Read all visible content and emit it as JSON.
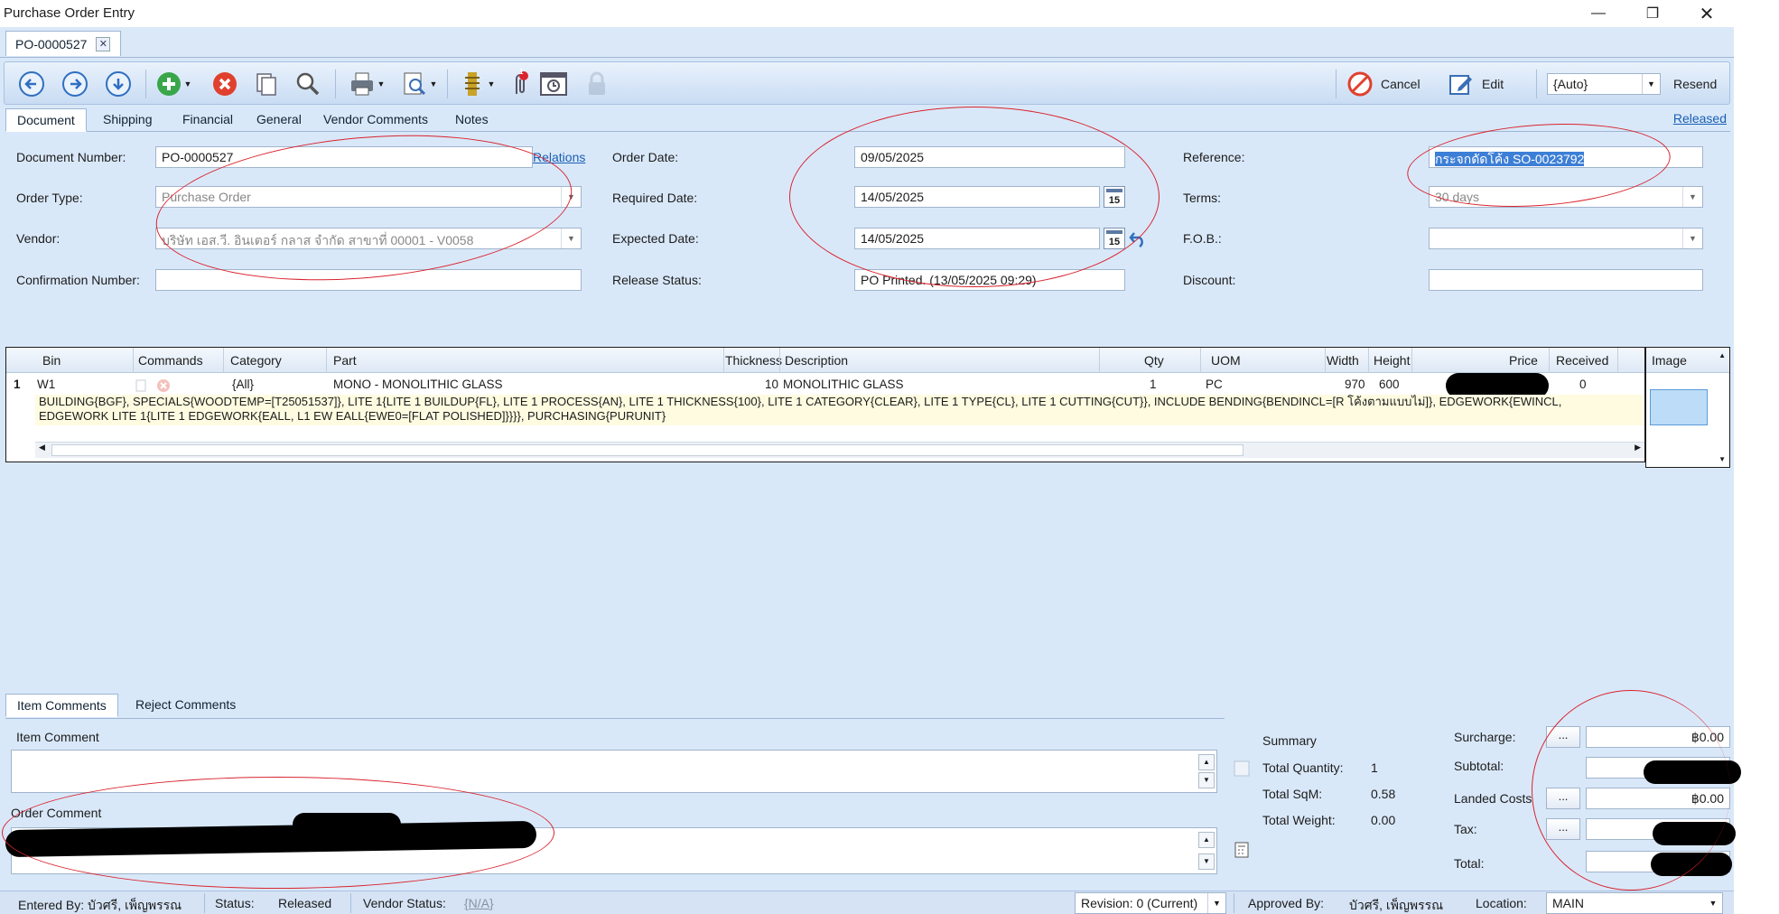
{
  "window": {
    "title": "Purchase Order Entry",
    "minimize": "—",
    "restore": "❐",
    "close": "✕"
  },
  "doc_tab": {
    "label": "PO-0000527",
    "close": "✕"
  },
  "toolbar": {
    "cancel_label": "Cancel",
    "edit_label": "Edit",
    "print_mode": "{Auto}",
    "resend_label": "Resend",
    "notification_count": "1"
  },
  "section_tabs": [
    "Document",
    "Shipping",
    "Financial",
    "General",
    "Vendor Comments",
    "Notes"
  ],
  "released_link": "Released",
  "form": {
    "document_number_label": "Document Number:",
    "document_number": "PO-0000527",
    "relations_link": "Relations",
    "order_type_label": "Order Type:",
    "order_type": "Purchase Order",
    "vendor_label": "Vendor:",
    "vendor": "บริษัท เอส.วี. อินเตอร์ กลาส  จำกัด สาขาที่ 00001 - V0058",
    "confirmation_number_label": "Confirmation Number:",
    "confirmation_number": "",
    "order_date_label": "Order Date:",
    "order_date": "09/05/2025",
    "required_date_label": "Required Date:",
    "required_date": "14/05/2025",
    "expected_date_label": "Expected Date:",
    "expected_date": "14/05/2025",
    "release_status_label": "Release Status:",
    "release_status": "PO Printed. (13/05/2025 09:29)",
    "reference_label": "Reference:",
    "reference": "กระจกดัดโค้ง SO-0023792",
    "terms_label": "Terms:",
    "terms": "30 days",
    "fob_label": "F.O.B.:",
    "fob": "",
    "discount_label": "Discount:",
    "discount": "",
    "calendar_day": "15"
  },
  "grid": {
    "headers": [
      "Bin",
      "Commands",
      "Category",
      "Part",
      "Thickness",
      "Description",
      "Qty",
      "UOM",
      "Width",
      "Height",
      "Price",
      "Received"
    ],
    "image_header": "Image",
    "row": {
      "num": "1",
      "bin": "W1",
      "category": "{All}",
      "part": "MONO - MONOLITHIC GLASS",
      "thickness": "10",
      "description": "MONOLITHIC GLASS",
      "qty": "1",
      "uom": "PC",
      "width": "970",
      "height": "600",
      "received": "0",
      "detail_line1": "BUILDING{BGF}, SPECIALS{WOODTEMP=[T25051537]}, LITE 1{LITE 1 BUILDUP{FL}, LITE 1 PROCESS{AN}, LITE 1 THICKNESS{100}, LITE 1 CATEGORY{CLEAR}, LITE 1 TYPE{CL}, LITE 1 CUTTING{CUT}}, INCLUDE BENDING{BENDINCL=[R โค้งตามแบบไม่]}, EDGEWORK{EWINCL,",
      "detail_line2": "EDGEWORK LITE 1{LITE 1 EDGEWORK{EALL, L1 EW EALL{EWE0=[FLAT POLISHED]}}}}, PURCHASING{PURUNIT}"
    }
  },
  "bottom_tabs": [
    "Item Comments",
    "Reject Comments"
  ],
  "comments": {
    "item_comment_label": "Item Comment",
    "order_comment_label": "Order Comment"
  },
  "summary": {
    "title": "Summary",
    "total_quantity_label": "Total Quantity:",
    "total_quantity": "1",
    "total_sqm_label": "Total SqM:",
    "total_sqm": "0.58",
    "total_weight_label": "Total Weight:",
    "total_weight": "0.00"
  },
  "totals": {
    "surcharge_label": "Surcharge:",
    "surcharge": "฿0.00",
    "subtotal_label": "Subtotal:",
    "landed_costs_label": "Landed Costs",
    "landed_costs": "฿0.00",
    "tax_label": "Tax:",
    "total_label": "Total:",
    "dots": "..."
  },
  "statusbar": {
    "entered_by": "Entered By: บัวศรี, เพ็ญพรรณ",
    "status_label": "Status:",
    "status": "Released",
    "vendor_status_label": "Vendor Status:",
    "vendor_status": "{N/A}",
    "revision": "Revision: 0 (Current)",
    "approved_by_label": "Approved By:",
    "approved_by": "บัวศรี, เพ็ญพรรณ",
    "location_label": "Location:",
    "location": "MAIN"
  },
  "colors": {
    "accent": "#1a5fb4",
    "annotation": "#d9232d",
    "background": "#d9e8f9"
  }
}
